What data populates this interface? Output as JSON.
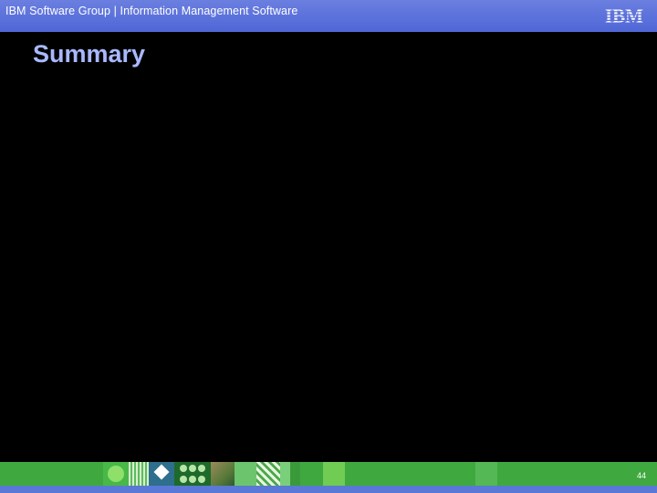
{
  "header": {
    "text": "IBM Software Group | Information Management Software",
    "logo": "IBM",
    "colors": {
      "background": "#5a70dc",
      "text": "#ffffff"
    }
  },
  "slide": {
    "title": "Summary",
    "title_color": "#a9b8ff",
    "background": "#000000"
  },
  "footer": {
    "page_number": "44",
    "color": "#3fa83f"
  }
}
